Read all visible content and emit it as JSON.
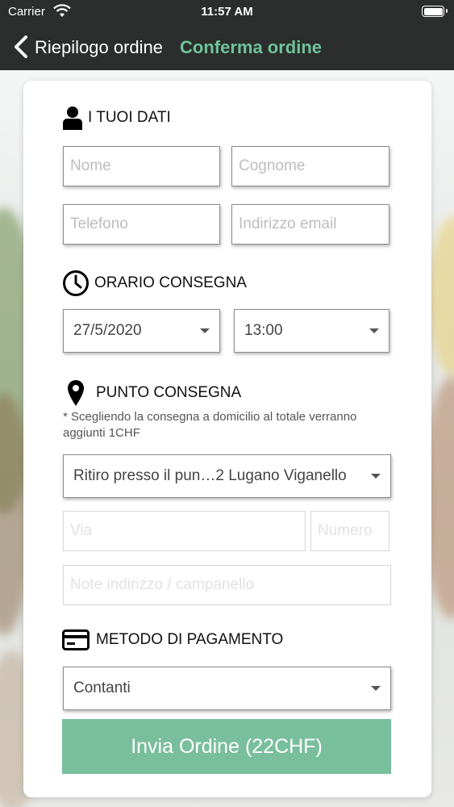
{
  "status_bar": {
    "carrier": "Carrier",
    "time": "11:57 AM"
  },
  "nav": {
    "back_label": "Riepilogo ordine",
    "title": "Conferma ordine"
  },
  "colors": {
    "nav_bg": "#2b2e2c",
    "accent": "#6fc49b",
    "submit_bg": "#79be9d"
  },
  "sections": {
    "personal": {
      "title": "I TUOI DATI",
      "icon": "user-icon"
    },
    "delivery_time": {
      "title": "ORARIO CONSEGNA",
      "icon": "clock-icon"
    },
    "delivery_point": {
      "title": "PUNTO CONSEGNA",
      "icon": "location-pin-icon",
      "note": "* Scegliendo la consegna a domicilio al totale verranno aggiunti 1CHF"
    },
    "payment": {
      "title": "METODO DI PAGAMENTO",
      "icon": "credit-card-icon"
    }
  },
  "fields": {
    "nome": {
      "placeholder": "Nome"
    },
    "cognome": {
      "placeholder": "Cognome"
    },
    "telefono": {
      "placeholder": "Telefono"
    },
    "email": {
      "placeholder": "Indirizzo email"
    },
    "via": {
      "placeholder": "Via"
    },
    "numero": {
      "placeholder": "Numero"
    },
    "note_indirizzo": {
      "placeholder": "Note indirizzo / campanello"
    }
  },
  "selects": {
    "date": "27/5/2020",
    "time": "13:00",
    "delivery_point": "Ritiro presso il pun…2 Lugano Viganello",
    "payment": "Contanti"
  },
  "submit_label": "Invia Ordine (22CHF)"
}
